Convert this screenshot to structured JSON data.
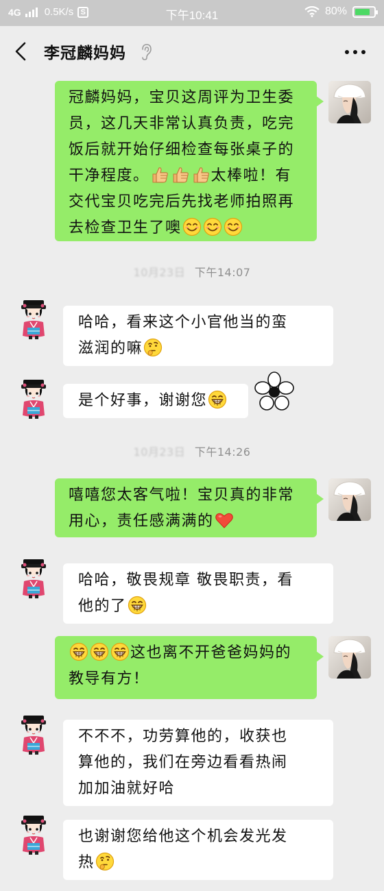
{
  "status_bar": {
    "network": "4G",
    "speed": "0.5K/s",
    "app_badge": "S",
    "time": "下午10:41",
    "battery": "80%",
    "battery_level": 0.8,
    "colors": {
      "background": "#c9c9c9",
      "battery_fill": "#4cd964"
    }
  },
  "header": {
    "title": "李冠麟妈妈",
    "icons": {
      "back": "chevron-left-icon",
      "mute": "ear-icon",
      "more": "more-dots-icon"
    }
  },
  "colors": {
    "bubble_sent": "#95ec69",
    "bubble_received": "#ffffff",
    "chat_background": "#ededed",
    "timestamp": "#8f8f8f"
  },
  "messages": [
    {
      "side": "right",
      "lines": [
        "冠麟妈妈，宝贝这周评为卫生委",
        "员，这几天非常认真负责，吃完",
        "饭后就开始仔细检查每张桌子的",
        "干净程度。",
        "太棒啦！有",
        "交代宝贝吃完后先找老师拍照再",
        "去检查卫生了噢"
      ],
      "emoji_thumbs": "thumbs-up-emoji",
      "emoji_smile": "smile-emoji"
    },
    {
      "side": "left",
      "lines": [
        "哈哈，看来这个小官他当的蛮",
        "滋润的嘛"
      ],
      "emoji": "thinking-emoji"
    },
    {
      "side": "left",
      "lines": [
        "是个好事，谢谢您"
      ],
      "emoji": "grin-emoji",
      "sticker": "flower-sticker"
    },
    {
      "side": "right",
      "lines": [
        "嘻嘻您太客气啦！宝贝真的非常",
        "用心，责任感满满的"
      ],
      "emoji": "red-heart-emoji"
    },
    {
      "side": "left",
      "lines": [
        "哈哈，敬畏规章 敬畏职责，看",
        "他的了"
      ],
      "emoji": "grin-emoji"
    },
    {
      "side": "right",
      "lines": [
        "这也离不开爸爸妈妈的",
        "教导有方！"
      ],
      "emoji": "grin-emoji"
    },
    {
      "side": "left",
      "lines": [
        "不不不，功劳算他的，收获也",
        "算他的，我们在旁边看看热闹",
        "加加油就好哈"
      ]
    },
    {
      "side": "left",
      "lines": [
        "也谢谢您给他这个机会发光发",
        "热"
      ],
      "emoji": "thinking-emoji"
    }
  ],
  "timestamps": [
    {
      "date_blurred": "10月23日",
      "time": "下午14:07"
    },
    {
      "date_blurred": "10月23日",
      "time": "下午14:26"
    }
  ]
}
